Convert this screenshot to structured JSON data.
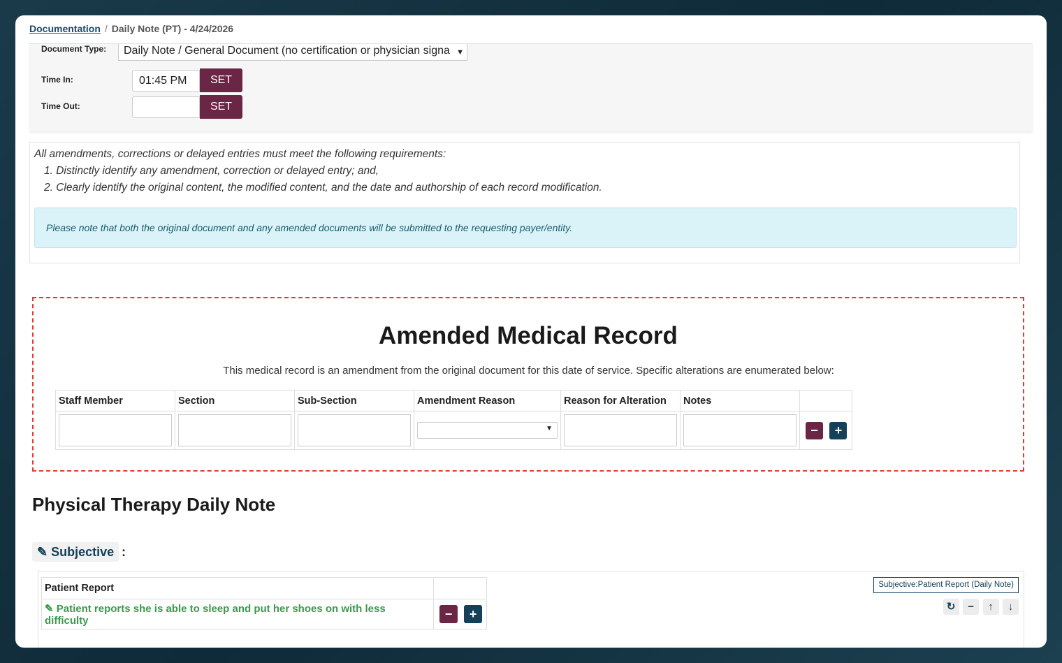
{
  "breadcrumb": {
    "root": "Documentation",
    "separator": "/",
    "current": "Daily Note (PT) - 4/24/2026"
  },
  "doc_form": {
    "document_type_label": "Document Type:",
    "document_type_value": "Daily Note / General Document (no certification or physician signa",
    "time_in_label": "Time In:",
    "time_in_value": "01:45 PM",
    "time_out_label": "Time Out:",
    "time_out_value": "",
    "set_label": "SET"
  },
  "requirements": {
    "intro": "All amendments, corrections or delayed entries must meet the following requirements:",
    "items": [
      "1. Distinctly identify any amendment, correction or delayed entry; and,",
      "2. Clearly identify the original content, the modified content, and the date and authorship of each record modification."
    ],
    "notice": "Please note that both the original document and any amended documents will be submitted to the requesting payer/entity."
  },
  "amendment": {
    "title": "Amended Medical Record",
    "subtitle": "This medical record is an amendment from the original document for this date of service. Specific alterations are enumerated below:",
    "columns": [
      "Staff Member",
      "Section",
      "Sub-Section",
      "Amendment Reason",
      "Reason for Alteration",
      "Notes",
      ""
    ],
    "reason_selected": ""
  },
  "note": {
    "heading": "Physical Therapy Daily Note",
    "subjective_label": "Subjective",
    "colon": ":",
    "patient_report_header": "Patient Report",
    "patient_report_text": "Patient reports she is able to sleep and put her shoes on with less difficulty",
    "tag": "Subjective:Patient Report (Daily Note)"
  },
  "icons": {
    "minus": "minus-icon",
    "plus": "plus-icon",
    "edit": "edit-icon",
    "refresh": "refresh-icon",
    "collapse": "collapse-icon",
    "up": "arrow-up-icon",
    "down": "arrow-down-icon"
  },
  "colors": {
    "primary_maroon": "#6b2545",
    "primary_navy": "#14405a",
    "alert_red": "#e53935",
    "notice_bg": "#d9f3f8",
    "success_green": "#3a9a4a"
  }
}
